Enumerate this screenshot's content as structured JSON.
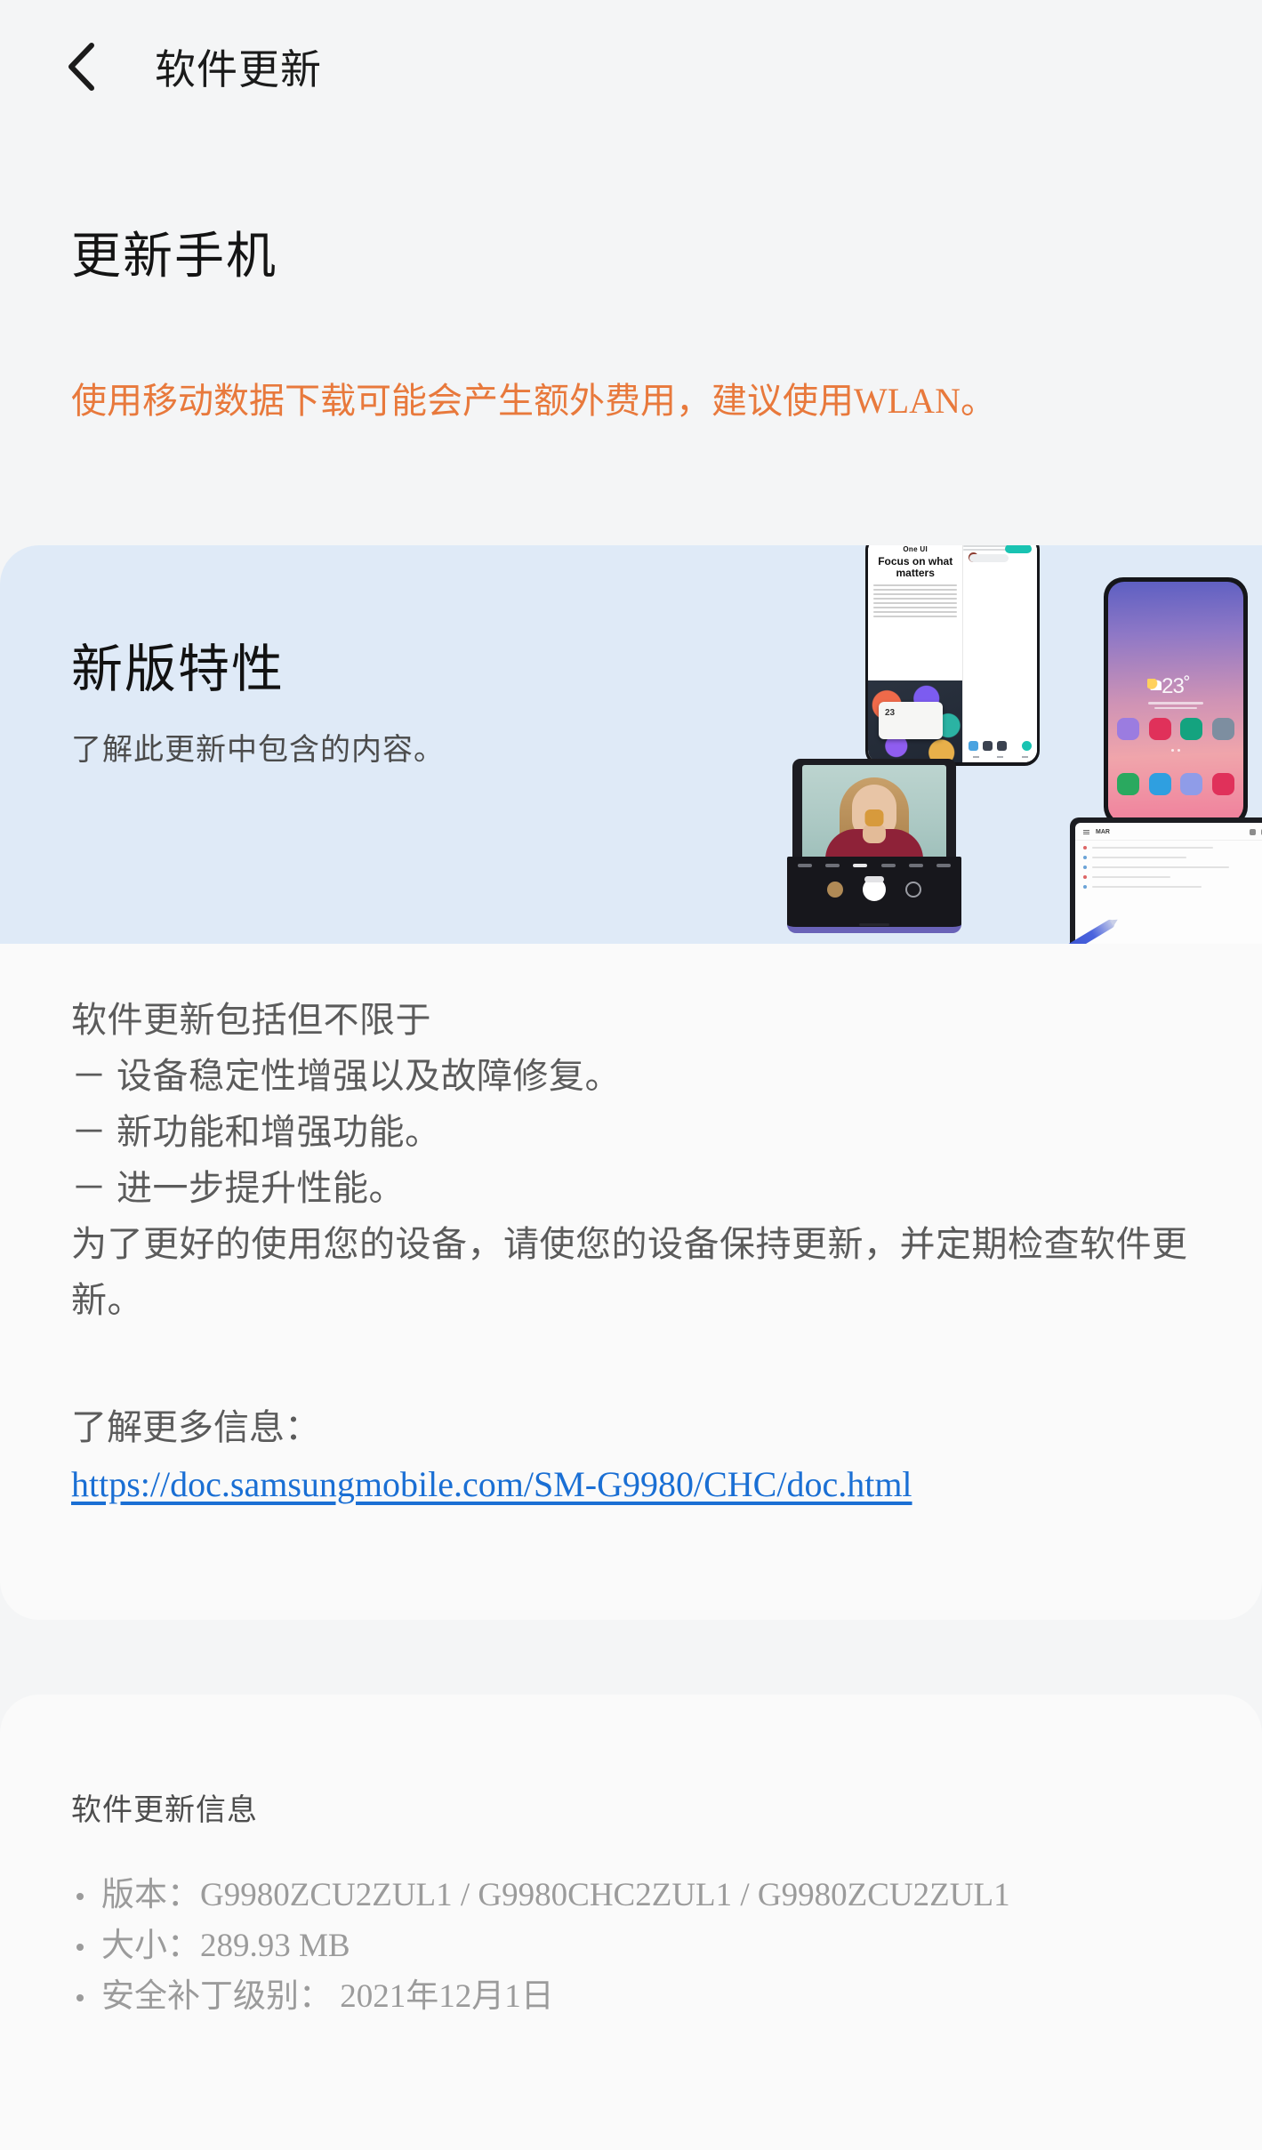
{
  "header": {
    "back_icon": "chevron-left-icon",
    "title": "软件更新"
  },
  "page": {
    "title": "更新手机",
    "notice": "使用移动数据下载可能会产生额外费用，建议使用WLAN。",
    "notice_color": "#e8793c"
  },
  "banner": {
    "title": "新版特性",
    "subtitle": "了解此更新中包含的内容。",
    "background_color": "#dfeaf7",
    "devices": {
      "phone_article": {
        "kicker": "One UI",
        "headline": "Focus on what matters"
      },
      "phone_home": {
        "temperature": "23˚"
      }
    }
  },
  "body": {
    "intro": "软件更新包括但不限于",
    "bullets": [
      "－ 设备稳定性增强以及故障修复。",
      "－ 新功能和增强功能。",
      "－ 进一步提升性能。"
    ],
    "closing": "为了更好的使用您的设备，请使您的设备保持更新，并定期检查软件更新。",
    "more_label": "了解更多信息：",
    "link_text": "https://doc.samsungmobile.com/SM-G9980/CHC/doc.html",
    "link_color": "#1a6fd4"
  },
  "info": {
    "title": "软件更新信息",
    "items": [
      "版本：G9980ZCU2ZUL1 / G9980CHC2ZUL1 / G9980ZCU2ZUL1",
      "大小：289.93 MB",
      "安全补丁级别： 2021年12月1日"
    ]
  }
}
